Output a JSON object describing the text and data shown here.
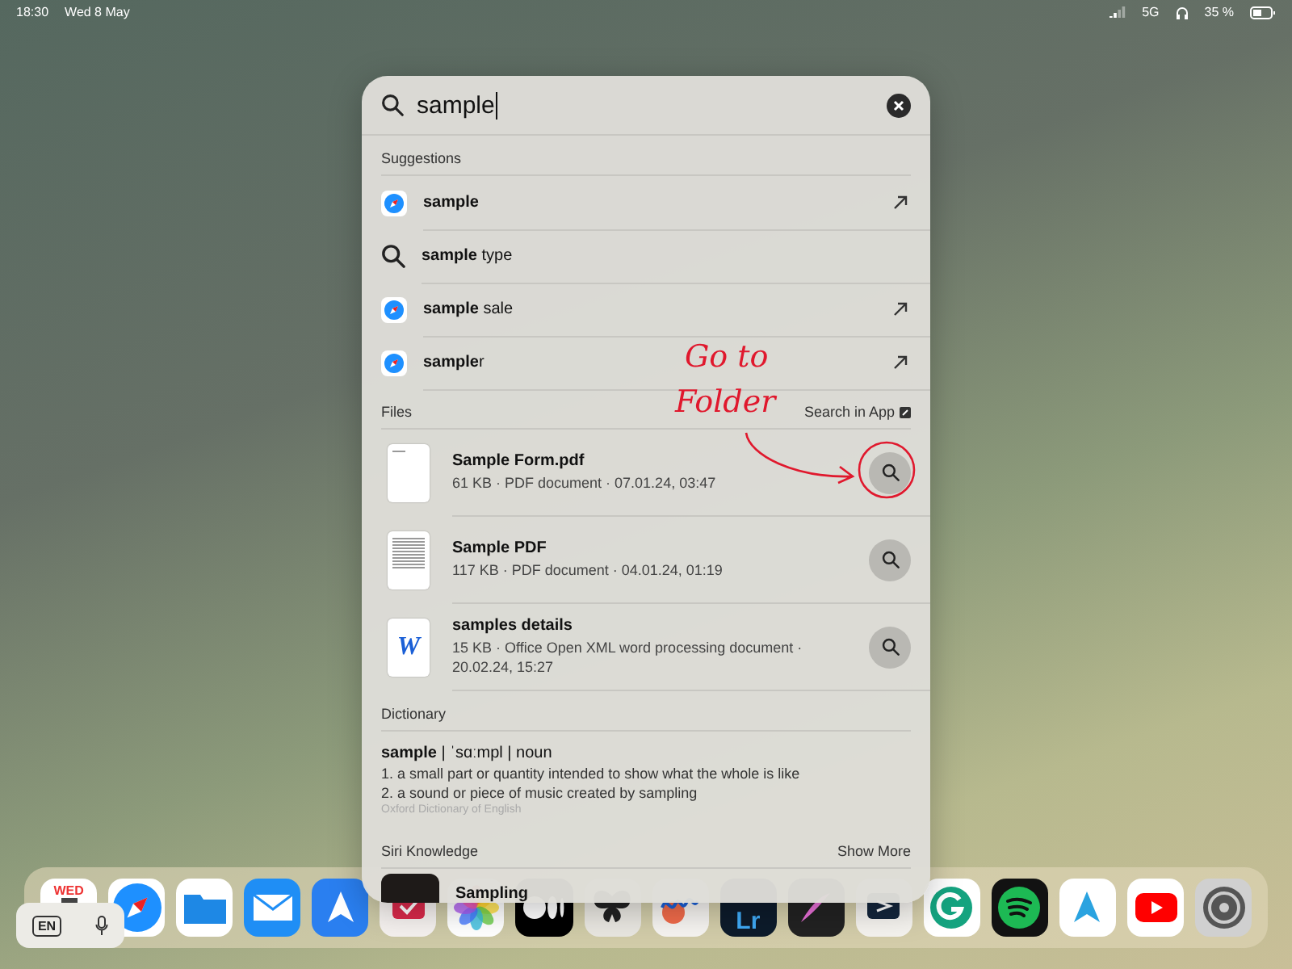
{
  "status_bar": {
    "time": "18:30",
    "date": "Wed 8 May",
    "network": "5G",
    "battery": "35 %"
  },
  "search": {
    "value": "sample"
  },
  "suggestions": {
    "title": "Suggestions",
    "items": [
      {
        "kind": "safari",
        "text": "**sample**"
      },
      {
        "kind": "search",
        "text": "**sample** type"
      },
      {
        "kind": "safari",
        "text": "**sample** sale"
      },
      {
        "kind": "safari",
        "text": "**sample**r"
      }
    ]
  },
  "files": {
    "title": "Files",
    "action": "Search in App",
    "items": [
      {
        "kind": "blank",
        "name": "Sample Form.pdf",
        "details": "61 KB · PDF document · 07.01.24, 03:47"
      },
      {
        "kind": "text",
        "name": "Sample PDF",
        "details": "117 KB · PDF document · 04.01.24, 01:19"
      },
      {
        "kind": "word",
        "icon_letter": "W",
        "name": "samples details",
        "details": "15 KB · Office Open XML word processing document · 20.02.24, 15:27"
      }
    ]
  },
  "dictionary": {
    "title": "Dictionary",
    "headword": "**sample** | ˈsɑːmpl | noun",
    "senses": [
      "1. a small part or quantity intended to show what the whole is like",
      "2. a sound or piece of music created by sampling"
    ],
    "source": "Oxford Dictionary of English"
  },
  "siri": {
    "title": "Siri Knowledge",
    "action": "Show More",
    "items": [
      {
        "title": "Sampling"
      }
    ]
  },
  "annotation": {
    "lines": [
      "Go to",
      "Folder"
    ]
  },
  "keyboard": {
    "language": "EN"
  },
  "dock": [
    {
      "kind": "calendar",
      "label": "WED"
    },
    {
      "kind": "safari"
    },
    {
      "kind": "files"
    },
    {
      "kind": "mail"
    },
    {
      "kind": "spark"
    },
    {
      "kind": "tasks"
    },
    {
      "kind": "photos"
    },
    {
      "kind": "medium"
    },
    {
      "kind": "butterfly"
    },
    {
      "kind": "freeform"
    },
    {
      "kind": "lightroom",
      "label": "Lr"
    },
    {
      "kind": "procreate"
    },
    {
      "kind": "share"
    },
    {
      "kind": "grammarly"
    },
    {
      "kind": "spotify"
    },
    {
      "kind": "telegram"
    },
    {
      "kind": "youtube"
    },
    {
      "kind": "settings"
    }
  ]
}
